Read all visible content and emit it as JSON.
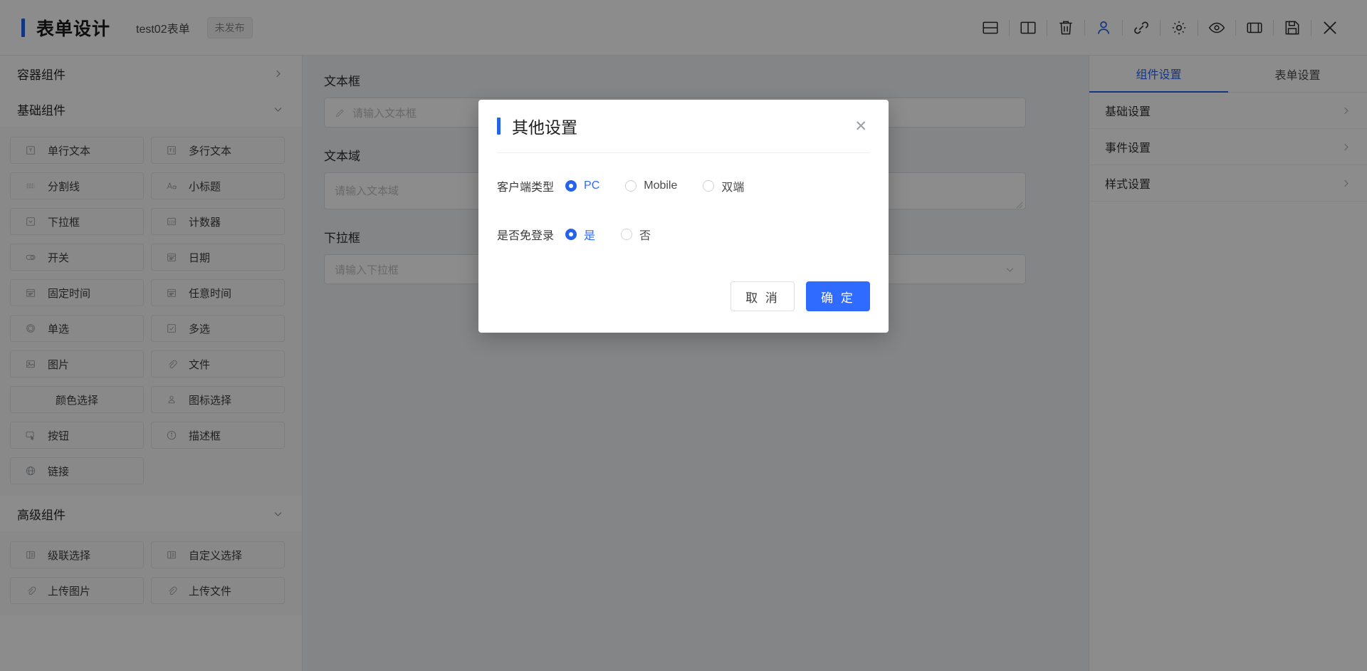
{
  "header": {
    "title": "表单设计",
    "doc_name": "test02表单",
    "status": "未发布",
    "tools": [
      {
        "name": "split-horizontal-icon",
        "label": "上下布局"
      },
      {
        "name": "split-vertical-icon",
        "label": "左右布局"
      },
      {
        "name": "trash-icon",
        "label": "删除"
      },
      {
        "name": "user-icon",
        "label": "用户"
      },
      {
        "name": "link-icon",
        "label": "链接"
      },
      {
        "name": "gear-icon",
        "label": "设置"
      },
      {
        "name": "eye-icon",
        "label": "预览"
      },
      {
        "name": "id-card-icon",
        "label": "表单信息"
      },
      {
        "name": "save-icon",
        "label": "保存"
      },
      {
        "name": "close-icon",
        "label": "关闭"
      }
    ]
  },
  "left_panel": {
    "groups": [
      {
        "title": "容器组件",
        "state": "collapsed",
        "chevron": "chevron-right-icon",
        "items": []
      },
      {
        "title": "基础组件",
        "state": "expanded",
        "chevron": "chevron-down-icon",
        "items": [
          {
            "label": "单行文本",
            "icon": "text-single-icon"
          },
          {
            "label": "多行文本",
            "icon": "text-multi-icon"
          },
          {
            "label": "分割线",
            "icon": "divider-icon"
          },
          {
            "label": "小标题",
            "icon": "heading-icon"
          },
          {
            "label": "下拉框",
            "icon": "select-icon"
          },
          {
            "label": "计数器",
            "icon": "counter-icon"
          },
          {
            "label": "开关",
            "icon": "switch-icon"
          },
          {
            "label": "日期",
            "icon": "calendar-icon"
          },
          {
            "label": "固定时间",
            "icon": "calendar-icon"
          },
          {
            "label": "任意时间",
            "icon": "calendar-icon"
          },
          {
            "label": "单选",
            "icon": "radio-icon"
          },
          {
            "label": "多选",
            "icon": "checkbox-icon"
          },
          {
            "label": "图片",
            "icon": "image-icon"
          },
          {
            "label": "文件",
            "icon": "paperclip-icon"
          },
          {
            "label": "颜色选择",
            "icon": ""
          },
          {
            "label": "图标选择",
            "icon": "person-icon"
          },
          {
            "label": "按钮",
            "icon": "button-icon"
          },
          {
            "label": "描述框",
            "icon": "info-icon"
          },
          {
            "label": "链接",
            "icon": "globe-icon"
          }
        ]
      },
      {
        "title": "高级组件",
        "state": "expanded",
        "chevron": "chevron-down-icon",
        "items": [
          {
            "label": "级联选择",
            "icon": "cascader-icon"
          },
          {
            "label": "自定义选择",
            "icon": "cascader-icon"
          },
          {
            "label": "上传图片",
            "icon": "paperclip-icon"
          },
          {
            "label": "上传文件",
            "icon": "paperclip-icon"
          }
        ]
      }
    ]
  },
  "canvas": {
    "fields": [
      {
        "label": "文本框",
        "type": "input",
        "placeholder": "请输入文本框",
        "icon": "pencil-icon"
      },
      {
        "label": "文本域",
        "type": "textarea",
        "placeholder": "请输入文本域"
      },
      {
        "label": "下拉框",
        "type": "select",
        "placeholder": "请输入下拉框",
        "icon": "chevron-down-icon"
      }
    ]
  },
  "right_panel": {
    "tabs": [
      {
        "label": "组件设置",
        "active": true
      },
      {
        "label": "表单设置",
        "active": false
      }
    ],
    "rows": [
      {
        "label": "基础设置",
        "icon": "chevron-right-icon"
      },
      {
        "label": "事件设置",
        "icon": "chevron-right-icon"
      },
      {
        "label": "样式设置",
        "icon": "chevron-right-icon"
      }
    ]
  },
  "modal": {
    "title": "其他设置",
    "close_icon": "close-icon",
    "rows": [
      {
        "label": "客户端类型",
        "options": [
          {
            "label": "PC",
            "checked": true
          },
          {
            "label": "Mobile",
            "checked": false
          },
          {
            "label": "双端",
            "checked": false
          }
        ]
      },
      {
        "label": "是否免登录",
        "options": [
          {
            "label": "是",
            "checked": true
          },
          {
            "label": "否",
            "checked": false
          }
        ]
      }
    ],
    "cancel_label": "取 消",
    "confirm_label": "确 定"
  },
  "colors": {
    "accent": "#2563eb",
    "primary_button": "#2f6bff",
    "text": "#303030",
    "muted": "#8c8c8c",
    "canvas_bg": "#f0f2f5"
  }
}
